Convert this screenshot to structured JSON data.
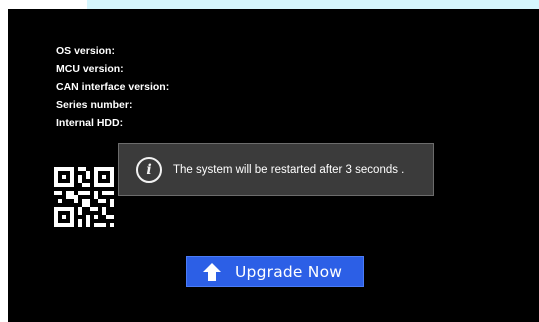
{
  "info": {
    "os_label": "OS version:",
    "mcu_label": "MCU version:",
    "can_label": "CAN interface version:",
    "series_label": "Series number:",
    "hdd_label": "Internal HDD:"
  },
  "toast": {
    "icon": "info-icon",
    "message": "The system will be restarted after  3 seconds ."
  },
  "upgrade_button": {
    "icon": "arrow-up-icon",
    "label": "Upgrade Now"
  },
  "colors": {
    "background": "#000000",
    "top_strip": "#d6f6fd",
    "toast_bg": "#3b3b3b",
    "button_bg": "#2c5fe6"
  }
}
